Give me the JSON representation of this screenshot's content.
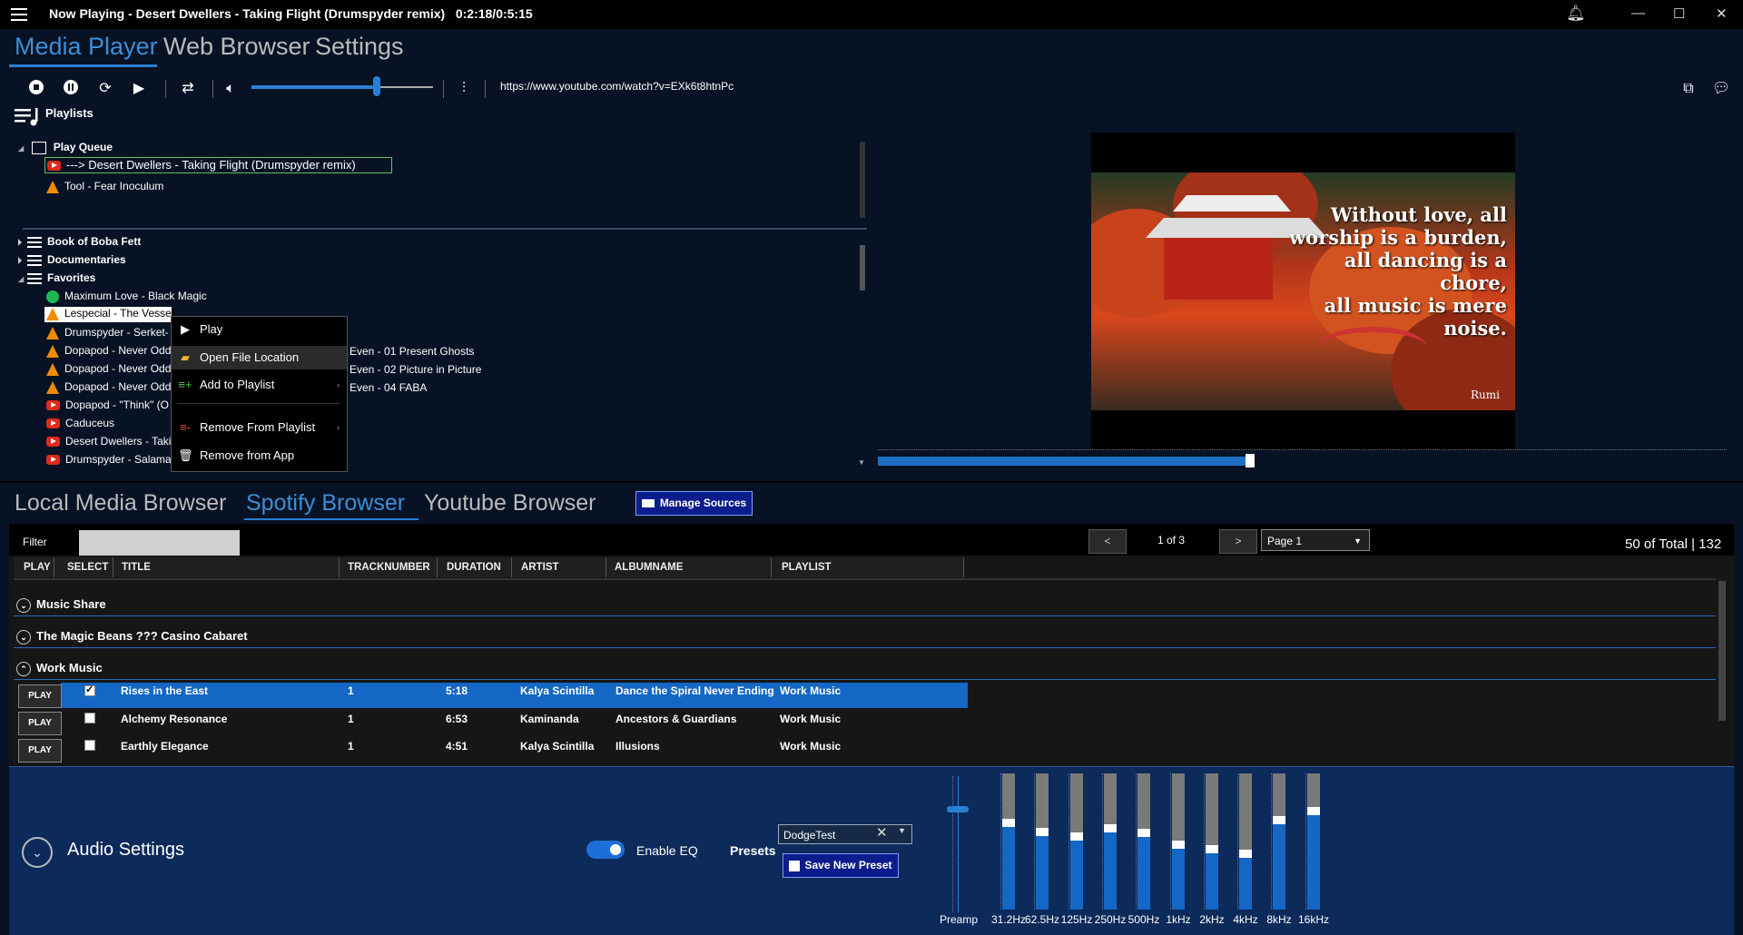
{
  "window": {
    "title": "Now Playing - Desert Dwellers - Taking Flight (Drumspyder remix)   0:2:18/0:5:15",
    "controls": [
      "—",
      "☐",
      "✕"
    ]
  },
  "main_tabs": [
    "Media Player",
    "Web Browser",
    "Settings"
  ],
  "toolbar": {
    "url": "https://www.youtube.com/watch?v=EXk6t8htnPc",
    "volume_percent": 71
  },
  "playlists": {
    "header": "Playlists",
    "play_queue": {
      "label": "Play Queue",
      "items": [
        {
          "icon": "youtube-icon",
          "label": "---> Desert Dwellers - Taking Flight (Drumspyder remix)"
        },
        {
          "icon": "vlc-icon",
          "label": "Tool - Fear Inoculum"
        }
      ]
    },
    "groups": [
      "Book of Boba Fett",
      "Documentaries",
      "Favorites"
    ],
    "favorites": [
      {
        "icon": "spotify-icon",
        "label": "Maximum Love - Black Magic"
      },
      {
        "icon": "vlc-icon",
        "label": "Lespecial - The Vessel"
      },
      {
        "icon": "vlc-icon",
        "label": "Drumspyder - Serket-"
      },
      {
        "icon": "vlc-icon",
        "label": "Dopapod - Never Odd",
        "suffix": "Even - 01 Present Ghosts"
      },
      {
        "icon": "vlc-icon",
        "label": "Dopapod - Never Odd",
        "suffix": "Even - 02 Picture in Picture"
      },
      {
        "icon": "vlc-icon",
        "label": "Dopapod - Never Odd",
        "suffix": "Even - 04 FABA"
      },
      {
        "icon": "youtube-icon",
        "label": "Dopapod - \"Think\" (O"
      },
      {
        "icon": "youtube-icon",
        "label": "Caduceus"
      },
      {
        "icon": "youtube-icon",
        "label": "Desert Dwellers - Takin"
      },
      {
        "icon": "youtube-icon",
        "label": "Drumspyder - Salama"
      }
    ]
  },
  "context_menu": [
    "Play",
    "Open File Location",
    "Add to Playlist",
    "Remove From Playlist",
    "Remove from App"
  ],
  "video": {
    "quote": [
      "Without love, all",
      "worship is a burden,",
      "all dancing is a chore,",
      "all music is mere noise."
    ],
    "author": "Rumi",
    "progress_fraction": 0.44
  },
  "browser_tabs": [
    "Local Media Browser",
    "Spotify Browser",
    "Youtube Browser"
  ],
  "manage_sources": "Manage Sources",
  "filter": {
    "label": "Filter",
    "value": ""
  },
  "pager": {
    "prev": "<",
    "next": ">",
    "page_of": "1 of 3",
    "page_select": "Page 1",
    "total": "50 of Total | 132"
  },
  "grid": {
    "columns": [
      "PLAY",
      "SELECT",
      "TITLE",
      "TRACKNUMBER",
      "DURATION",
      "ARTIST",
      "ALBUMNAME",
      "PLAYLIST"
    ],
    "groups": [
      "Music Share",
      "The Magic Beans ??? Casino Cabaret",
      "Work Music"
    ],
    "play_label": "PLAY",
    "rows": [
      {
        "selected": true,
        "title": "Rises in the East",
        "track": "1",
        "duration": "5:18",
        "artist": "Kalya Scintilla",
        "album": "Dance the Spiral Never Ending",
        "playlist": "Work Music"
      },
      {
        "selected": false,
        "title": "Alchemy Resonance",
        "track": "1",
        "duration": "6:53",
        "artist": "Kaminanda",
        "album": "Ancestors & Guardians",
        "playlist": "Work Music"
      },
      {
        "selected": false,
        "title": "Earthly Elegance",
        "track": "1",
        "duration": "4:51",
        "artist": "Kalya Scintilla",
        "album": "Illusions",
        "playlist": "Work Music"
      }
    ]
  },
  "audio": {
    "title": "Audio Settings",
    "enable_eq_label": "Enable EQ",
    "enable_eq": true,
    "presets_label": "Presets",
    "preset_value": "DodgeTest",
    "save_preset": "Save New Preset",
    "preamp_label": "Preamp",
    "bands": [
      {
        "label": "31.2Hz",
        "level": 0.63
      },
      {
        "label": "62.5Hz",
        "level": 0.57
      },
      {
        "label": "125Hz",
        "level": 0.53
      },
      {
        "label": "250Hz",
        "level": 0.59
      },
      {
        "label": "500Hz",
        "level": 0.56
      },
      {
        "label": "1kHz",
        "level": 0.47
      },
      {
        "label": "2kHz",
        "level": 0.44
      },
      {
        "label": "4kHz",
        "level": 0.41
      },
      {
        "label": "8kHz",
        "level": 0.65
      },
      {
        "label": "16kHz",
        "level": 0.72
      }
    ]
  },
  "colors": {
    "accent": "#2a7fd4",
    "selected_row": "#1467c4",
    "button_dark_blue": "#0b1c8c"
  }
}
